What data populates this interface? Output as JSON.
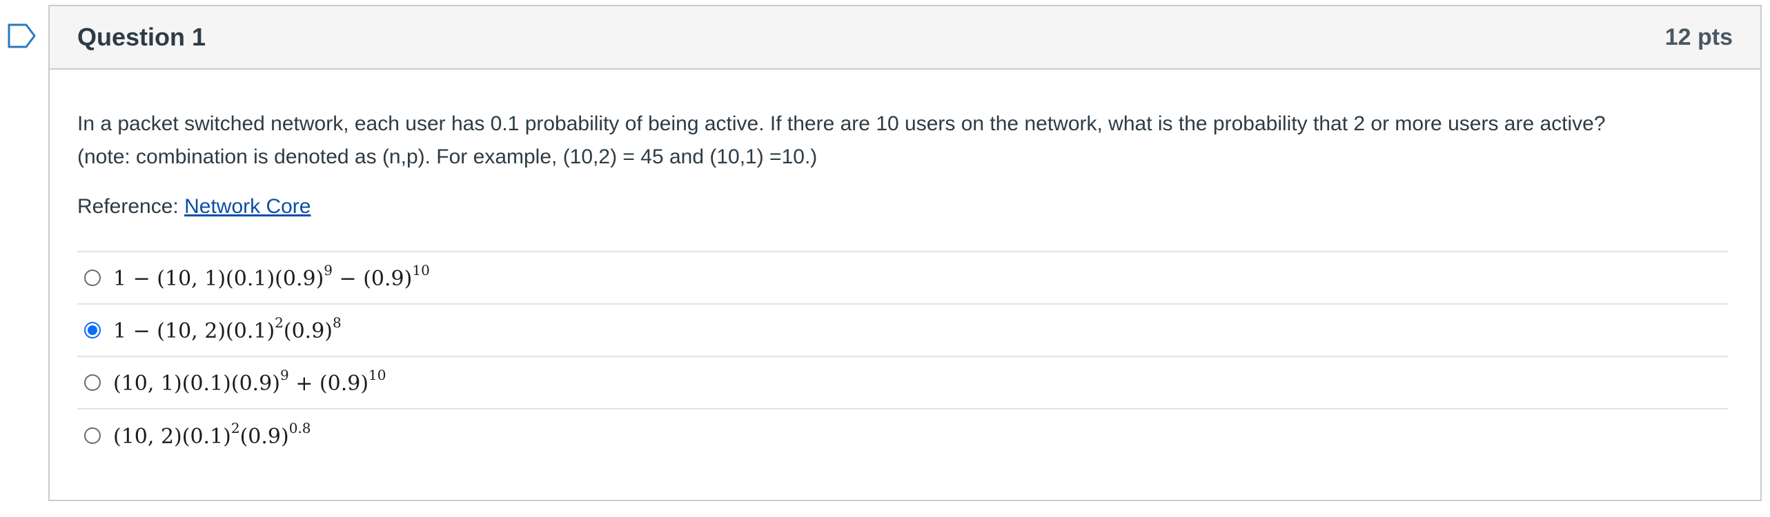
{
  "question": {
    "title": "Question 1",
    "points": "12 pts",
    "text_line1": "In a packet switched network, each user has 0.1 probability of being active. If there are 10 users on the network, what is the probability that 2 or more users are active?",
    "text_line2": "(note: combination is denoted as (n,p). For example, (10,2) = 45 and (10,1) =10.)",
    "reference_label": "Reference:",
    "reference_link": "Network Core"
  },
  "answers": [
    {
      "base": "1 − (10, 1)(0.1)(0.9)",
      "exp1": "9",
      "mid": " − (0.9)",
      "exp2": "10",
      "tail": "",
      "exp3": "",
      "selected": false
    },
    {
      "base": "1 − (10, 2)(0.1)",
      "exp1": "2",
      "mid": "(0.9)",
      "exp2": "8",
      "tail": "",
      "exp3": "",
      "selected": true
    },
    {
      "base": "(10, 1)(0.1)(0.9)",
      "exp1": "9",
      "mid": " + (0.9)",
      "exp2": "10",
      "tail": "",
      "exp3": "",
      "selected": false
    },
    {
      "base": "(10, 2)(0.1)",
      "exp1": "2",
      "mid": "(0.9)",
      "exp2": "0.8",
      "tail": "",
      "exp3": "",
      "selected": false
    }
  ],
  "colors": {
    "accent": "#0b6ef5",
    "link": "#0b4fa6",
    "border": "#c7cdd1",
    "header_bg": "#f5f5f5"
  },
  "icons": {
    "bookmark": "bookmark-flag-icon"
  }
}
